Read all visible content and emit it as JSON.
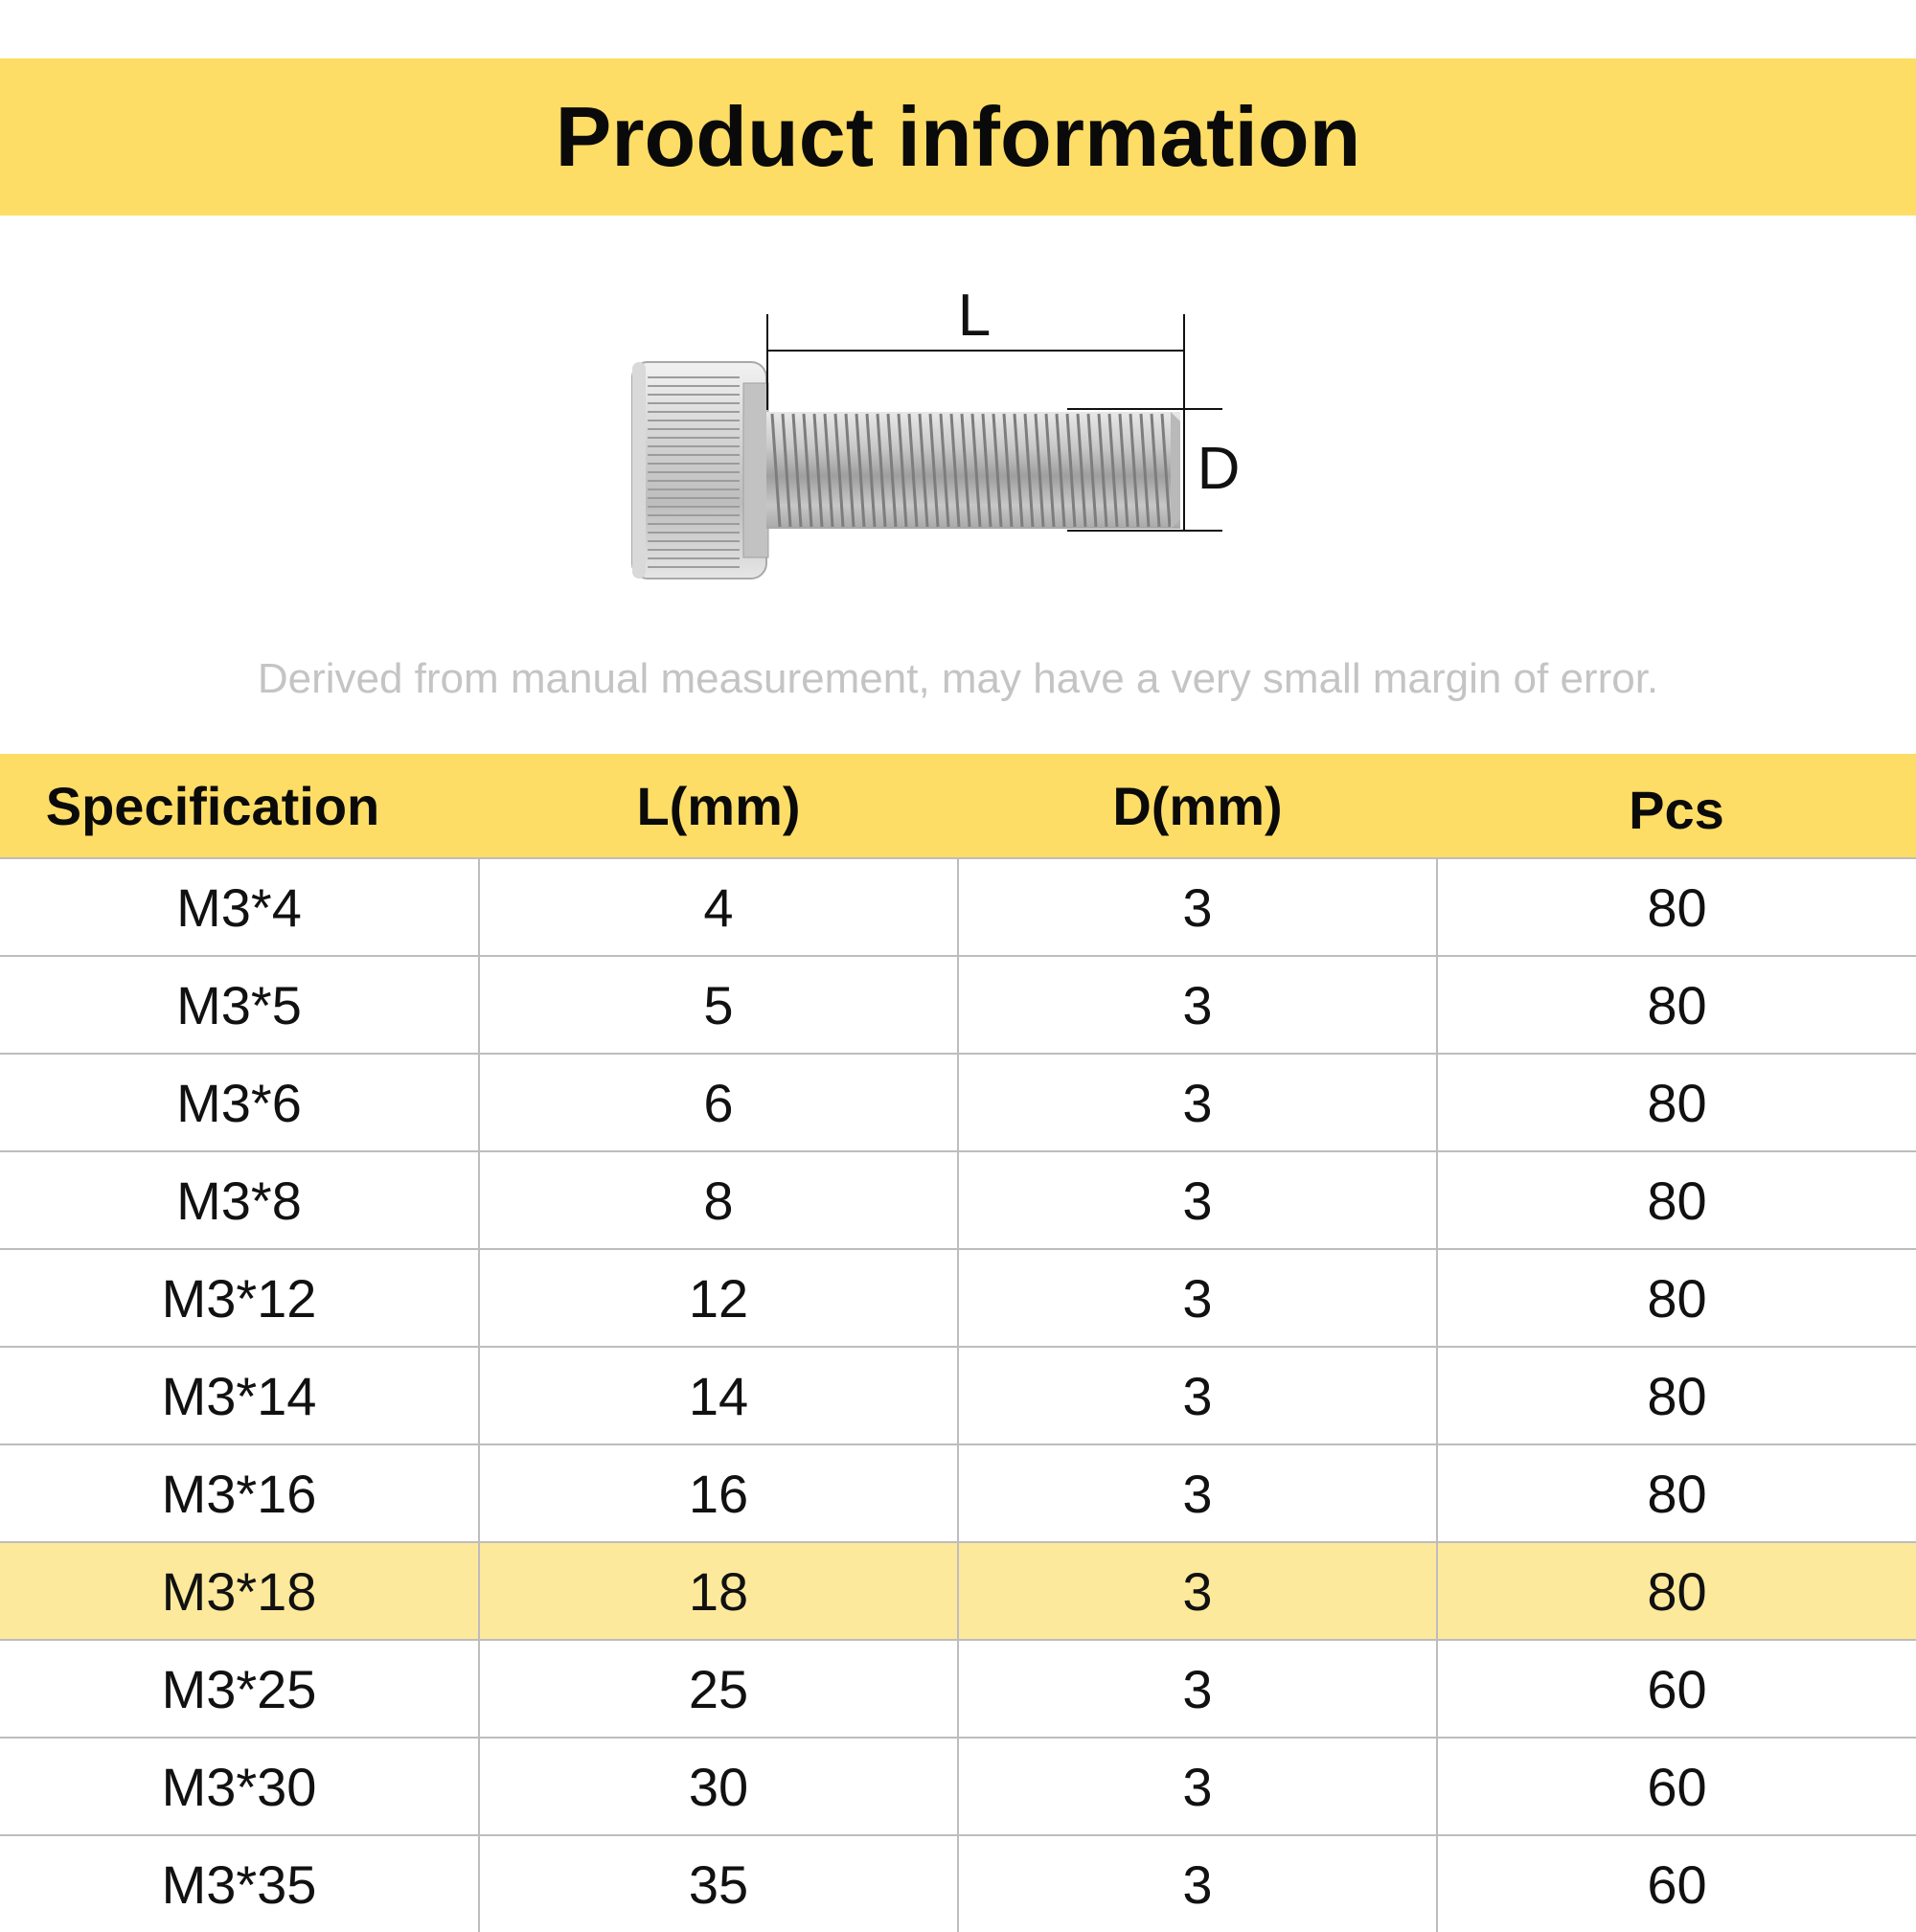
{
  "header": {
    "title": "Product information"
  },
  "diagram": {
    "length_label": "L",
    "diameter_label": "D",
    "icon": "socket-head-cap-screw"
  },
  "note": "Derived from manual measurement, may have a very small margin of error.",
  "table": {
    "columns": [
      "Specification",
      "L(mm)",
      "D(mm)",
      "Pcs"
    ],
    "rows": [
      {
        "spec": "M3*4",
        "l": "4",
        "d": "3",
        "pcs": "80"
      },
      {
        "spec": "M3*5",
        "l": "5",
        "d": "3",
        "pcs": "80"
      },
      {
        "spec": "M3*6",
        "l": "6",
        "d": "3",
        "pcs": "80"
      },
      {
        "spec": "M3*8",
        "l": "8",
        "d": "3",
        "pcs": "80"
      },
      {
        "spec": "M3*12",
        "l": "12",
        "d": "3",
        "pcs": "80"
      },
      {
        "spec": "M3*14",
        "l": "14",
        "d": "3",
        "pcs": "80"
      },
      {
        "spec": "M3*16",
        "l": "16",
        "d": "3",
        "pcs": "80"
      },
      {
        "spec": "M3*18",
        "l": "18",
        "d": "3",
        "pcs": "80"
      },
      {
        "spec": "M3*25",
        "l": "25",
        "d": "3",
        "pcs": "60"
      },
      {
        "spec": "M3*30",
        "l": "30",
        "d": "3",
        "pcs": "60"
      },
      {
        "spec": "M3*35",
        "l": "35",
        "d": "3",
        "pcs": "60"
      }
    ],
    "highlighted_row": "M3*18"
  },
  "colors": {
    "accent_yellow": "#fddd66",
    "highlight_row": "#fde99c",
    "grid_line": "#bdbdbd",
    "note_text": "#c4c4c4"
  }
}
